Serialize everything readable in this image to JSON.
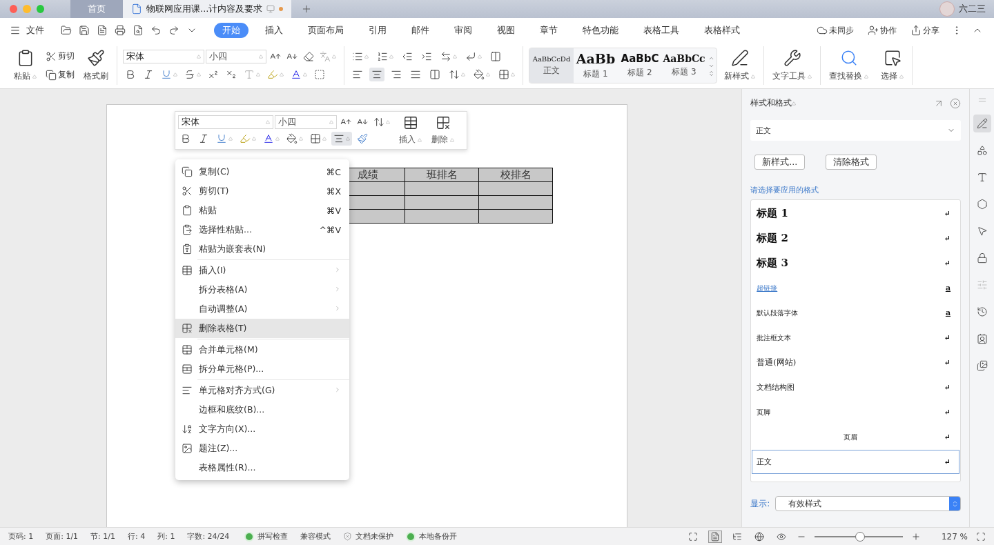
{
  "title_bar": {
    "tabs": [
      {
        "label": "首页",
        "selected": false,
        "modified": false
      },
      {
        "label": "物联网应用课...计内容及要求",
        "selected": true,
        "modified": true
      }
    ],
    "user": "六二三"
  },
  "menu_bar": {
    "file": "文件",
    "tabs": [
      {
        "label": "开始",
        "selected": true
      },
      {
        "label": "插入",
        "selected": false
      },
      {
        "label": "页面布局",
        "selected": false
      },
      {
        "label": "引用",
        "selected": false
      },
      {
        "label": "邮件",
        "selected": false
      },
      {
        "label": "审阅",
        "selected": false
      },
      {
        "label": "视图",
        "selected": false
      },
      {
        "label": "章节",
        "selected": false
      },
      {
        "label": "特色功能",
        "selected": false
      },
      {
        "label": "表格工具",
        "selected": false
      },
      {
        "label": "表格样式",
        "selected": false
      }
    ],
    "actions": [
      "未同步",
      "协作",
      "分享"
    ]
  },
  "ribbon": {
    "paste": "粘贴",
    "cut": "剪切",
    "copy": "复制",
    "format_painter": "格式刷",
    "font": "宋体",
    "size": "小四",
    "styles": [
      {
        "sample": "AaBbCcDd",
        "label": "正文",
        "kind": "normal",
        "selected": true
      },
      {
        "sample": "AaBb",
        "label": "标题 1",
        "kind": "h1",
        "selected": false
      },
      {
        "sample": "AaBbC",
        "label": "标题 2",
        "kind": "h2",
        "selected": false
      },
      {
        "sample": "AaBbCc",
        "label": "标题 3",
        "kind": "h3",
        "selected": false
      }
    ],
    "tools": [
      "新样式",
      "文字工具",
      "查找替换",
      "选择"
    ]
  },
  "mini_toolbar": {
    "font": "宋体",
    "size": "小四",
    "insert": "插入",
    "delete": "删除"
  },
  "table": {
    "columns": [
      "成绩",
      "班排名",
      "校排名"
    ],
    "rows": [
      {
        "shaded": true
      },
      {
        "shaded": true
      },
      {
        "shaded": true
      }
    ]
  },
  "context_menu": [
    [
      {
        "label": "复制(C)",
        "shortcut": "⌘C",
        "submenu": false,
        "selected": false
      },
      {
        "label": "剪切(T)",
        "shortcut": "⌘X",
        "submenu": false,
        "selected": false
      },
      {
        "label": "粘贴",
        "shortcut": "⌘V",
        "submenu": false,
        "selected": false
      },
      {
        "label": "选择性粘贴...",
        "shortcut": "^⌘V",
        "submenu": false,
        "selected": false
      },
      {
        "label": "粘贴为嵌套表(N)",
        "submenu": false,
        "selected": false
      }
    ],
    [
      {
        "label": "插入(I)",
        "submenu": true,
        "selected": false
      },
      {
        "label": "拆分表格(A)",
        "submenu": true,
        "selected": false
      },
      {
        "label": "自动调整(A)",
        "submenu": true,
        "selected": false
      },
      {
        "label": "删除表格(T)",
        "submenu": false,
        "selected": true
      }
    ],
    [
      {
        "label": "合并单元格(M)",
        "submenu": false,
        "selected": false
      },
      {
        "label": "拆分单元格(P)...",
        "submenu": false,
        "selected": false
      }
    ],
    [
      {
        "label": "单元格对齐方式(G)",
        "submenu": true,
        "selected": false
      },
      {
        "label": "边框和底纹(B)...",
        "submenu": false,
        "selected": false
      },
      {
        "label": "文字方向(X)...",
        "submenu": false,
        "selected": false
      },
      {
        "label": "题注(Z)...",
        "submenu": false,
        "selected": false
      },
      {
        "label": "表格属性(R)...",
        "submenu": false,
        "selected": false
      }
    ]
  ],
  "styles_panel": {
    "title": "样式和格式",
    "current": "正文",
    "buttons": [
      "新样式...",
      "清除格式"
    ],
    "hint": "请选择要应用的格式",
    "styles": [
      {
        "label": "标题 1",
        "kind": "heading",
        "mark": "↵",
        "selected": false
      },
      {
        "label": "标题 2",
        "kind": "heading",
        "mark": "↵",
        "selected": false
      },
      {
        "label": "标题 3",
        "kind": "heading",
        "mark": "↵",
        "selected": false
      },
      {
        "label": "超链接",
        "kind": "link",
        "mark": "a",
        "selected": false
      },
      {
        "label": "默认段落字体",
        "kind": "small",
        "mark": "a",
        "selected": false
      },
      {
        "label": "批注框文本",
        "kind": "tiny",
        "mark": "↵",
        "selected": false
      },
      {
        "label": "普通(网站)",
        "kind": "normal",
        "mark": "↵",
        "selected": false
      },
      {
        "label": "文档结构图",
        "kind": "plain",
        "mark": "↵",
        "selected": false
      },
      {
        "label": "页脚",
        "kind": "tiny",
        "mark": "↵",
        "selected": false
      },
      {
        "label": "页眉",
        "kind": "centered",
        "mark": "↵",
        "selected": false
      },
      {
        "label": "正文",
        "kind": "plain",
        "mark": "↵",
        "selected": true
      }
    ],
    "show_label": "显示:",
    "show_value": "有效样式"
  },
  "side_tools": [
    {
      "selected": true
    },
    {
      "selected": false
    },
    {
      "selected": false
    },
    {
      "selected": false
    },
    {
      "selected": false
    },
    {
      "selected": false
    },
    {
      "selected": false
    },
    {
      "selected": false
    },
    {
      "selected": false
    },
    {
      "selected": false
    }
  ],
  "status_bar": {
    "items": [
      {
        "kind": "text",
        "label": "页码: 1"
      },
      {
        "kind": "text",
        "label": "页面: 1/1"
      },
      {
        "kind": "text",
        "label": "节: 1/1"
      },
      {
        "kind": "text",
        "label": "行: 4"
      },
      {
        "kind": "text",
        "label": "列: 1"
      },
      {
        "kind": "text",
        "label": "字数: 24/24"
      },
      {
        "kind": "dot",
        "label": "拼写检查",
        "color": "#4caf50"
      },
      {
        "kind": "text",
        "label": "兼容模式"
      },
      {
        "kind": "shield",
        "label": "文档未保护"
      },
      {
        "kind": "dot",
        "label": "本地备份开",
        "color": "#4caf50"
      }
    ],
    "views": [
      {
        "selected": false
      },
      {
        "selected": true
      },
      {
        "selected": false
      },
      {
        "selected": false
      },
      {
        "selected": false
      }
    ],
    "zoom": {
      "level": 0.52,
      "reading": "127 %"
    }
  }
}
